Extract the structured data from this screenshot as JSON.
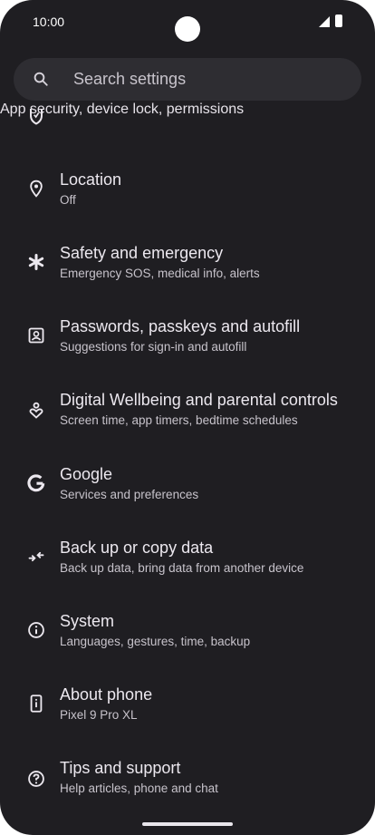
{
  "status_bar": {
    "time": "10:00"
  },
  "search": {
    "placeholder": "Search settings"
  },
  "partial_item": {
    "subtitle": "App security, device lock, permissions"
  },
  "items": [
    {
      "title": "Location",
      "subtitle": "Off",
      "icon": "location-pin-icon"
    },
    {
      "title": "Safety and emergency",
      "subtitle": "Emergency SOS, medical info, alerts",
      "icon": "asterisk-icon"
    },
    {
      "title": "Passwords, passkeys and autofill",
      "subtitle": "Suggestions for sign-in and autofill",
      "icon": "passwords-icon"
    },
    {
      "title": "Digital Wellbeing and parental controls",
      "subtitle": "Screen time, app timers, bedtime schedules",
      "icon": "wellbeing-icon"
    },
    {
      "title": "Google",
      "subtitle": "Services and preferences",
      "icon": "google-icon"
    },
    {
      "title": "Back up or copy data",
      "subtitle": "Back up data, bring data from another device",
      "icon": "backup-icon"
    },
    {
      "title": "System",
      "subtitle": "Languages, gestures, time, backup",
      "icon": "info-icon"
    },
    {
      "title": "About phone",
      "subtitle": "Pixel 9 Pro XL",
      "icon": "phone-icon"
    },
    {
      "title": "Tips and support",
      "subtitle": "Help articles, phone and chat",
      "icon": "help-icon"
    }
  ]
}
